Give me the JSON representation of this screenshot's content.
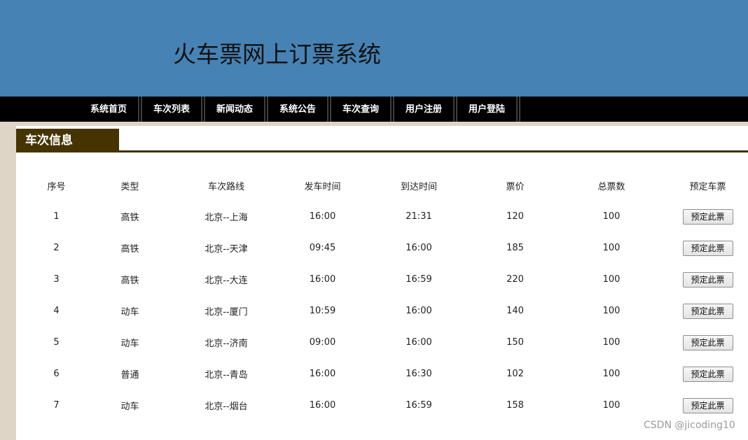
{
  "header": {
    "title": "火车票网上订票系统"
  },
  "nav": {
    "items": [
      "系统首页",
      "车次列表",
      "新闻动态",
      "系统公告",
      "车次查询",
      "用户注册",
      "用户登陆"
    ]
  },
  "section": {
    "title": "车次信息"
  },
  "table": {
    "columns": [
      "序号",
      "类型",
      "车次路线",
      "发车时间",
      "到达时间",
      "票价",
      "总票数",
      "预定车票"
    ],
    "book_label": "预定此票",
    "rows": [
      [
        "1",
        "高铁",
        "北京--上海",
        "16:00",
        "21:31",
        "120",
        "100"
      ],
      [
        "2",
        "高铁",
        "北京--天津",
        "09:45",
        "16:00",
        "185",
        "100"
      ],
      [
        "3",
        "高铁",
        "北京--大连",
        "16:00",
        "16:59",
        "220",
        "100"
      ],
      [
        "4",
        "动车",
        "北京--厦门",
        "10:59",
        "16:00",
        "140",
        "100"
      ],
      [
        "5",
        "动车",
        "北京--济南",
        "09:00",
        "16:00",
        "150",
        "100"
      ],
      [
        "6",
        "普通",
        "北京--青岛",
        "16:00",
        "16:30",
        "102",
        "100"
      ],
      [
        "7",
        "动车",
        "北京--烟台",
        "16:00",
        "16:59",
        "158",
        "100"
      ]
    ]
  },
  "watermark": "CSDN @jicoding10",
  "colors": {
    "header_bg": "#4682b4",
    "nav_bg": "#000000",
    "section_title_bg": "#463400",
    "page_bg": "#ded5c6"
  }
}
